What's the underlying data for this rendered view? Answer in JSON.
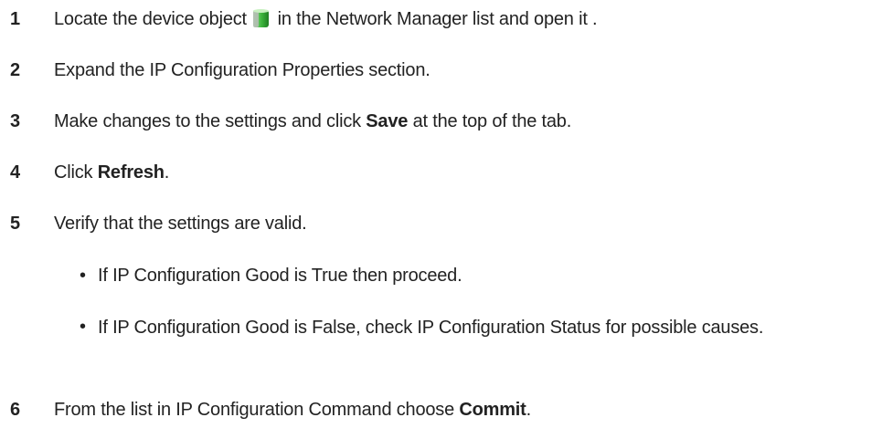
{
  "steps": [
    {
      "number": "1",
      "before": "Locate the device object",
      "icon": "green-device-cylinder-icon",
      "after": " in the Network Manager list and open it ."
    },
    {
      "number": "2",
      "text": "Expand the IP Configuration Properties section."
    },
    {
      "number": "3",
      "before": "Make changes to the settings and click ",
      "bold": "Save",
      "after": " at the top of the tab."
    },
    {
      "number": "4",
      "before": "Click ",
      "bold": "Refresh",
      "after": "."
    },
    {
      "number": "5",
      "text": "Verify that the settings are valid.",
      "bullets": [
        "If IP Configuration Good is True then proceed.",
        "If IP Configuration Good is False, check IP Configuration Status for possible causes."
      ]
    },
    {
      "number": "6",
      "before": "From the list in IP Configuration Command choose ",
      "bold": "Commit",
      "after": "."
    }
  ],
  "bullet_glyph": "•",
  "colors": {
    "text": "#222222",
    "icon_green": "#3cb43c",
    "icon_gray": "#a0a8a0"
  }
}
